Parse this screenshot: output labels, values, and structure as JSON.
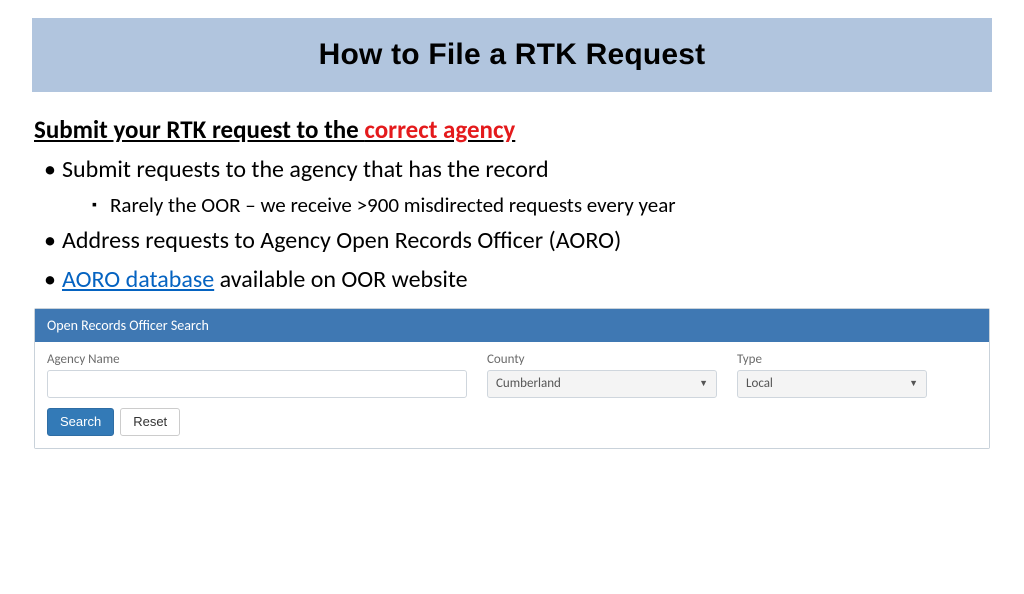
{
  "title": "How to File a RTK Request",
  "subhead_prefix": "Submit your RTK request to the ",
  "subhead_red": "correct agency",
  "bullets": {
    "b1": "Submit requests to the agency that has the record",
    "b1_sub": "Rarely the OOR – we receive >900 misdirected requests every year",
    "b2": "Address requests to Agency Open Records Officer (AORO)",
    "b3_link": "AORO database",
    "b3_rest": " available on OOR website"
  },
  "panel": {
    "header": "Open Records Officer Search",
    "agency_label": "Agency Name",
    "agency_value": "",
    "county_label": "County",
    "county_value": "Cumberland",
    "type_label": "Type",
    "type_value": "Local",
    "search_btn": "Search",
    "reset_btn": "Reset"
  }
}
